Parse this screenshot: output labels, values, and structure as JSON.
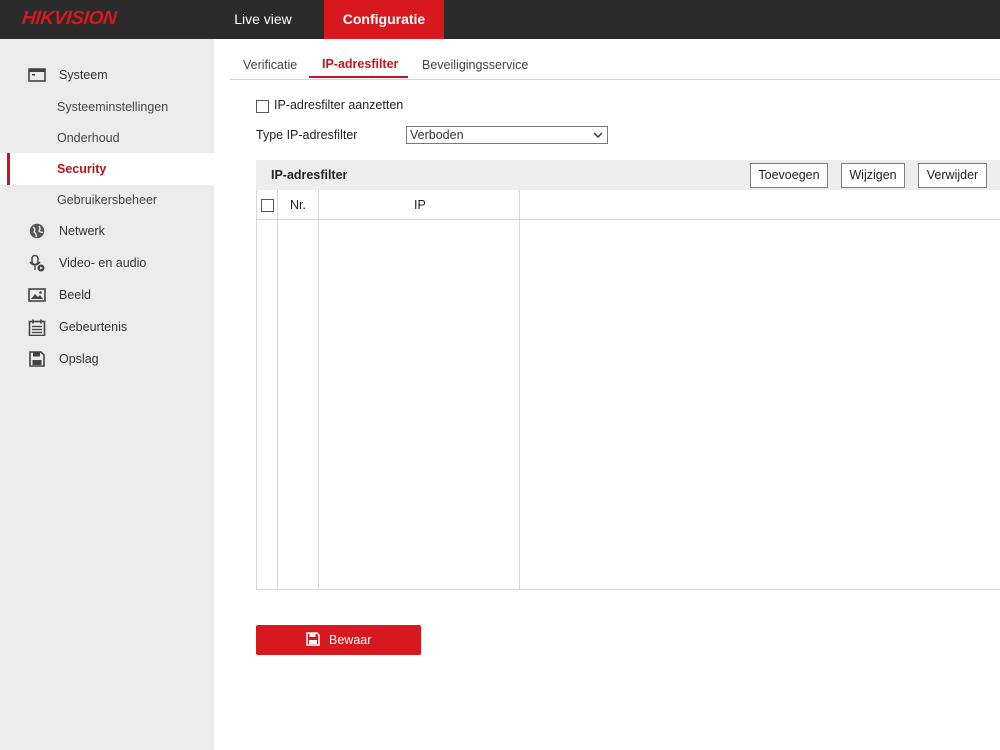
{
  "header": {
    "logo": "HIKVISION",
    "nav": [
      "Live view",
      "Configuratie"
    ]
  },
  "sidebar": {
    "items": [
      {
        "label": "Systeem",
        "icon": "system-window-icon"
      },
      {
        "label": "Systeeminstellingen"
      },
      {
        "label": "Onderhoud"
      },
      {
        "label": "Security",
        "active": true
      },
      {
        "label": "Gebruikersbeheer"
      },
      {
        "label": "Netwerk",
        "icon": "globe-icon"
      },
      {
        "label": "Video- en audio",
        "icon": "microphone-camera-icon"
      },
      {
        "label": "Beeld",
        "icon": "image-icon"
      },
      {
        "label": "Gebeurtenis",
        "icon": "calendar-icon"
      },
      {
        "label": "Opslag",
        "icon": "floppy-disk-icon"
      }
    ]
  },
  "tabs": [
    "Verificatie",
    "IP-adresfilter",
    "Beveiligingsservice"
  ],
  "form": {
    "enable_label": "IP-adresfilter aanzetten",
    "enable_checked": false,
    "type_label": "Type IP-adresfilter",
    "type_value": "Verboden"
  },
  "table": {
    "title": "IP-adresfilter",
    "buttons": [
      "Toevoegen",
      "Wijzigen",
      "Verwijder"
    ],
    "columns": [
      "Nr.",
      "IP"
    ],
    "rows": []
  },
  "save_label": "Bewaar",
  "colors": {
    "accent": "#d7181f",
    "topbar": "#2b2b2b",
    "sidebar": "#ececec"
  }
}
